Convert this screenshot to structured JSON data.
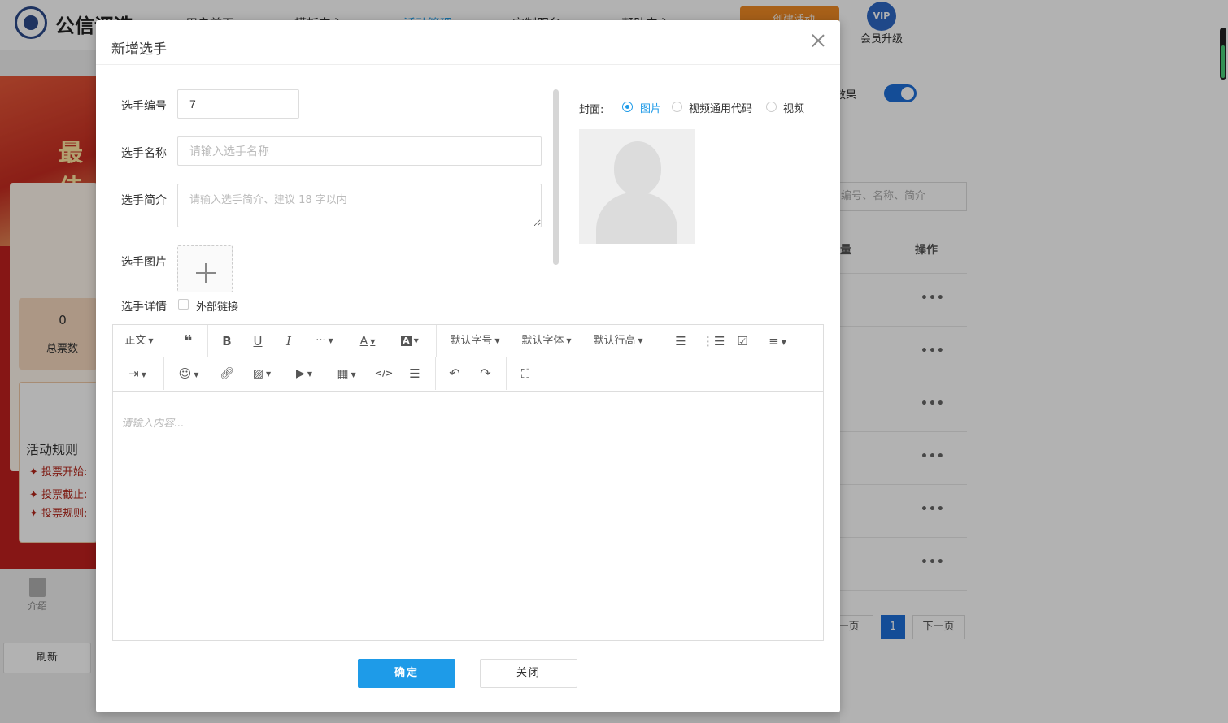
{
  "header": {
    "logo_text": "公信评选",
    "nav": [
      "用户首页",
      "模板中心",
      "活动管理",
      "定制服务",
      "帮助中心"
    ],
    "cta": "创建活动",
    "vip_badge": "VIP",
    "vip_label": "会员升级"
  },
  "left_panel": {
    "banner_title": "最佳",
    "total_votes_value": "0",
    "total_votes_label": "总票数",
    "rules_title": "活动规则",
    "rules": [
      "投票开始:",
      "投票截止:",
      "投票规则:"
    ],
    "intro_label": "介绍",
    "refresh_label": "刷新"
  },
  "right_panel": {
    "effect_label": "效果",
    "search_placeholder": "编号、名称、简介",
    "col_votes": "量",
    "col_actions": "操作",
    "row_action": "•••",
    "prev_page": "上一页",
    "current_page": "1",
    "next_page": "下一页"
  },
  "modal": {
    "title": "新增选手",
    "fields": {
      "number_label": "选手编号",
      "number_value": "7",
      "name_label": "选手名称",
      "name_placeholder": "请输入选手名称",
      "intro_label": "选手简介",
      "intro_placeholder": "请输入选手简介、建议 18 字以内",
      "image_label": "选手图片",
      "detail_label": "选手详情",
      "external_link_label": "外部链接"
    },
    "cover": {
      "label": "封面:",
      "options": [
        "图片",
        "视频通用代码",
        "视频"
      ],
      "selected": "图片"
    },
    "editor": {
      "toolbar": {
        "paragraph": "正文",
        "font_size": "默认字号",
        "font_family": "默认字体",
        "line_height": "默认行高",
        "more": "···"
      },
      "placeholder": "请输入内容..."
    },
    "confirm_label": "确定",
    "close_label": "关闭"
  }
}
